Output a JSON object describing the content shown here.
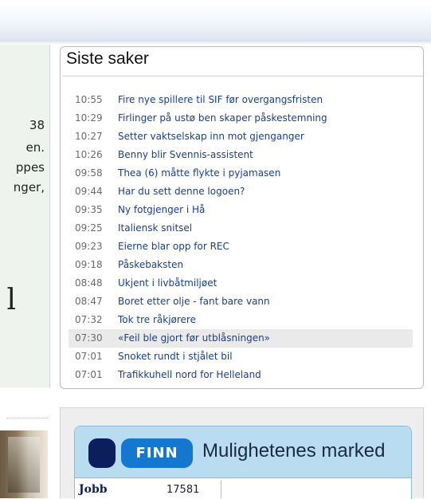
{
  "left_panel": {
    "fragments": [
      "38",
      "en.",
      "ppes",
      "nger,",
      "l"
    ]
  },
  "news": {
    "title": "Siste saker",
    "items": [
      {
        "time": "10:55",
        "headline": "Fire nye spillere til SIF før overgangsfristen"
      },
      {
        "time": "10:29",
        "headline": "Firlinger på ustø ben skaper påskestemning"
      },
      {
        "time": "10:27",
        "headline": "Setter vaktselskap inn mot gjenganger"
      },
      {
        "time": "10:26",
        "headline": "Benny blir Svennis-assistent"
      },
      {
        "time": "09:58",
        "headline": "Thea (6) måtte flykte i pyjamasen"
      },
      {
        "time": "09:44",
        "headline": "Har du sett denne logoen?"
      },
      {
        "time": "09:35",
        "headline": "Ny fotgjenger i Hå"
      },
      {
        "time": "09:25",
        "headline": "Italiensk snitsel"
      },
      {
        "time": "09:23",
        "headline": "Eierne blar opp for REC"
      },
      {
        "time": "09:18",
        "headline": "Påskebaksten"
      },
      {
        "time": "08:48",
        "headline": "Ukjent i livbåtmiljøet"
      },
      {
        "time": "08:47",
        "headline": "Boret etter olje - fant bare vann"
      },
      {
        "time": "07:32",
        "headline": "Tok tre råkjørere"
      },
      {
        "time": "07:30",
        "headline": "«Feil ble gjort før utblåsningen»"
      },
      {
        "time": "07:01",
        "headline": "Snoket rundt i stjålet bil"
      },
      {
        "time": "07:01",
        "headline": "Trafikkuhell nord for Helleland"
      }
    ],
    "highlighted_index": 13
  },
  "finn": {
    "logo_text": "FINN",
    "tagline": "Mulighetenes marked",
    "category": "Jobb",
    "count": "17581"
  },
  "colors": {
    "link": "#1a3f8f",
    "finn_dark": "#0c1e5b",
    "finn_blue": "#1478d0",
    "finn_header_bg": "#b9dcf0"
  }
}
